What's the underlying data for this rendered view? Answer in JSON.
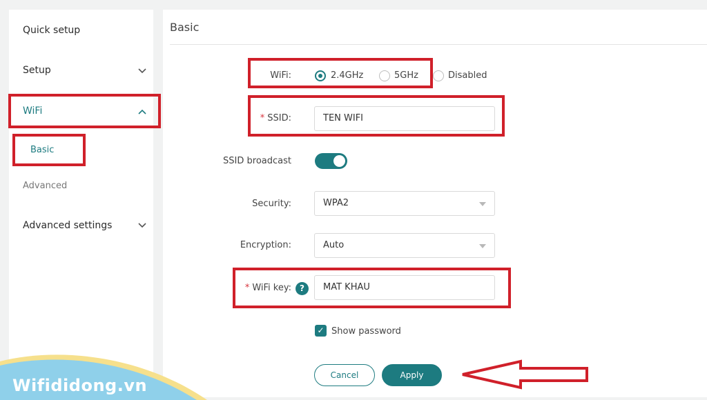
{
  "sidebar": {
    "quick_setup": "Quick setup",
    "setup": "Setup",
    "wifi": "WiFi",
    "basic": "Basic",
    "advanced": "Advanced",
    "advanced_settings": "Advanced settings"
  },
  "main": {
    "title": "Basic",
    "wifi_label": "WiFi:",
    "wifi_options": [
      "2.4GHz",
      "5GHz",
      "Disabled"
    ],
    "wifi_selected": "2.4GHz",
    "ssid_label": "SSID:",
    "ssid_value": "TEN WIFI",
    "ssid_broadcast_label": "SSID broadcast",
    "ssid_broadcast_on": true,
    "security_label": "Security:",
    "security_value": "WPA2",
    "encryption_label": "Encryption:",
    "encryption_value": "Auto",
    "wifi_key_label": "WiFi key:",
    "wifi_key_value": "MAT KHAU",
    "show_password_label": "Show password",
    "show_password_checked": true,
    "cancel_label": "Cancel",
    "apply_label": "Apply"
  },
  "watermark": "Wifididong.vn",
  "colors": {
    "accent": "#1d7b80",
    "highlight": "#d0202a",
    "required": "#d8343d"
  },
  "icons": {
    "chevron_down": "chevron-down-icon",
    "chevron_up": "chevron-up-icon",
    "help": "help-icon",
    "check": "check-icon",
    "arrow": "arrow-left-icon"
  }
}
